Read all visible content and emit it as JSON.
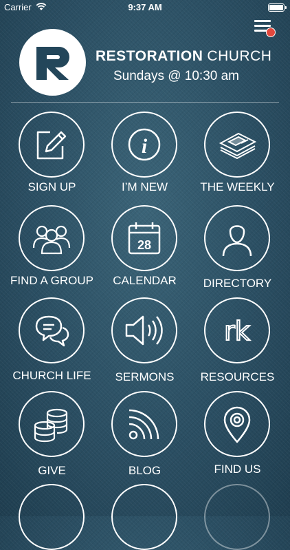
{
  "status": {
    "carrier": "Carrier",
    "time": "9:37 AM"
  },
  "header": {
    "name_bold": "RESTORATION",
    "name_light": "CHURCH",
    "service_time": "Sundays @ 10:30 am"
  },
  "tiles": [
    {
      "label": "SIGN UP",
      "icon": "pencil-square-icon"
    },
    {
      "label": "I’M NEW",
      "icon": "info-icon"
    },
    {
      "label": "THE WEEKLY",
      "icon": "newspaper-stack-icon"
    },
    {
      "label": "FIND A GROUP",
      "icon": "group-icon"
    },
    {
      "label": "CALENDAR",
      "icon": "calendar-icon",
      "day": "28"
    },
    {
      "label": "DIRECTORY",
      "icon": "person-icon"
    },
    {
      "label": "CHURCH LIFE",
      "icon": "chat-bubbles-icon"
    },
    {
      "label": "SERMONS",
      "icon": "speaker-icon"
    },
    {
      "label": "RESOURCES",
      "icon": "rk-icon",
      "glyph": "rk"
    },
    {
      "label": "GIVE",
      "icon": "coins-icon"
    },
    {
      "label": "BLOG",
      "icon": "rss-icon"
    },
    {
      "label": "FIND US",
      "icon": "map-pin-icon"
    }
  ],
  "colors": {
    "background": "#2b4f63",
    "accent_dot": "#e2483d",
    "foreground": "#ffffff"
  }
}
